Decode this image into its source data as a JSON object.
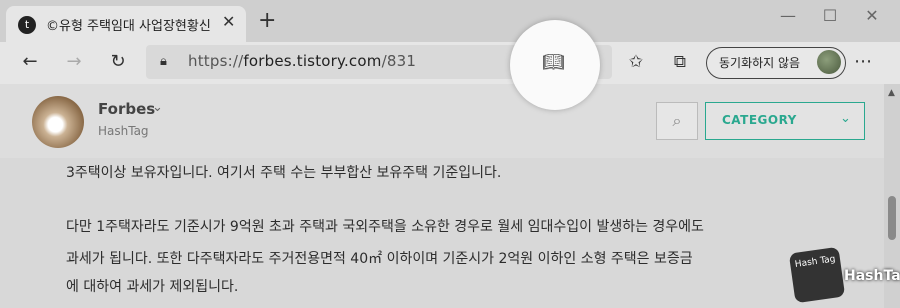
{
  "tab": {
    "title": "©유형 주택임대 사업장현황신고",
    "favicon": "tistory-favicon"
  },
  "toolbar": {
    "url_scheme": "https://",
    "url_host": "forbes.tistory.com",
    "url_path": "/831",
    "sync_label": "동기화하지 않음"
  },
  "blog": {
    "name": "Forbes",
    "tagline": "HashTag",
    "category_label": "CATEGORY"
  },
  "content": {
    "lines": [
      "3주택이상 보유자입니다. 여기서 주택 수는 부부합산 보유주택 기준입니다.",
      " 다만 1주택자라도 기준시가 9억원 초과 주택과 국외주택을 소유한 경우로 월세 임대수입이 발생하는 경우에도",
      "과세가 됩니다.  또한 다주택자라도 주거전용면적 40㎡ 이하이며 기준시가 2억원 이하인 소형 주택은 보증금",
      "에 대하여 과세가 제외됩니다."
    ]
  },
  "watermark": {
    "logo_text": "Hash Tag",
    "text": "HashTag"
  },
  "colors": {
    "accent": "#2aa88f",
    "chrome": "#e6e6e6"
  }
}
